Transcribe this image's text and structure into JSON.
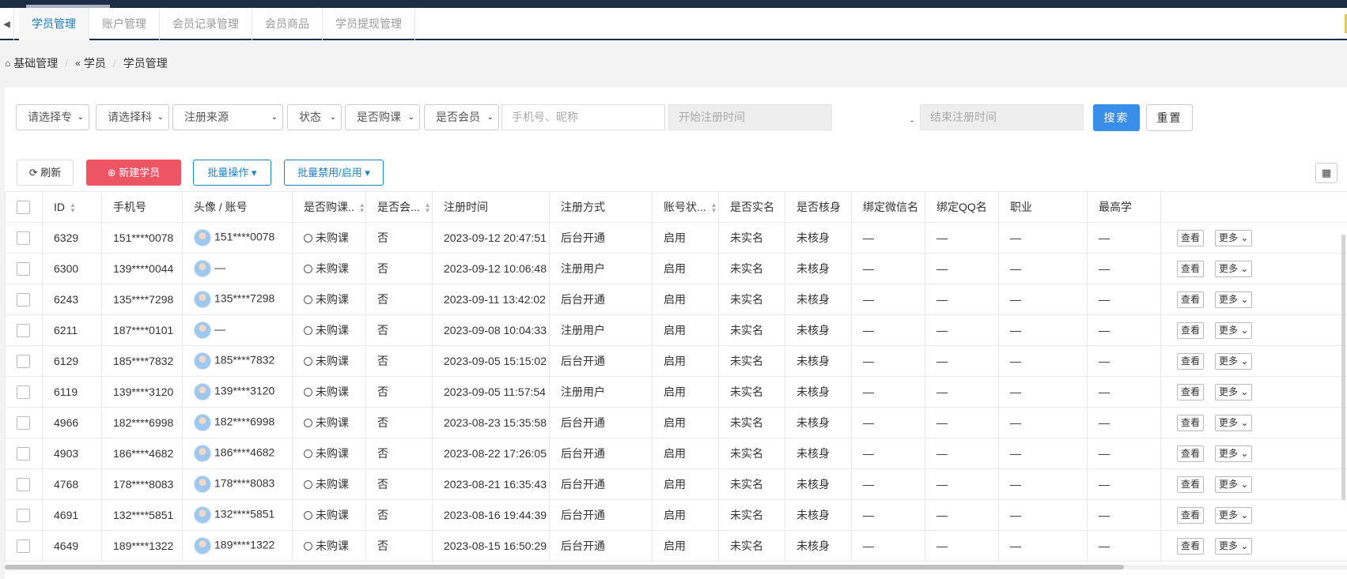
{
  "tabs": [
    {
      "label": "学员管理",
      "active": true
    },
    {
      "label": "账户管理"
    },
    {
      "label": "会员记录管理"
    },
    {
      "label": "会员商品"
    },
    {
      "label": "学员提现管理"
    }
  ],
  "breadcrumb": {
    "home_icon": "home-icon",
    "items": [
      "基础管理",
      "学员",
      "学员管理"
    ]
  },
  "filters": {
    "select1": "请选择专",
    "select2": "请选择科",
    "register_source": "注册来源",
    "status": "状态",
    "has_purchase": "是否购课",
    "is_member": "是否会员",
    "keyword_placeholder": "手机号、昵称",
    "start_date_placeholder": "开始注册时间",
    "date_dash": "-",
    "end_date_placeholder": "结束注册时间",
    "search_label": "搜索",
    "reset_label": "重置"
  },
  "toolbar": {
    "refresh_label": "刷新",
    "new_label": "新建学员",
    "batch_label": "批量操作",
    "ban_label": "批量禁用/启用"
  },
  "table": {
    "columns": [
      "ID",
      "手机号",
      "头像 / 账号",
      "是否购课..",
      "是否会...",
      "注册时间",
      "注册方式",
      "账号状...",
      "是否实名",
      "是否核身",
      "绑定微信名",
      "绑定QQ名",
      "职业",
      "最高学"
    ],
    "rows": [
      {
        "id": "6329",
        "phone": "151****0078",
        "account": "151****0078",
        "purchase": "未购课",
        "member": "否",
        "time": "2023-09-12 20:47:51",
        "method": "后台开通",
        "status": "启用",
        "realname": "未实名",
        "verify": "未核身",
        "wechat": "—",
        "qq": "—",
        "job": "—",
        "edu": "—"
      },
      {
        "id": "6300",
        "phone": "139****0044",
        "account": "—",
        "purchase": "未购课",
        "member": "否",
        "time": "2023-09-12 10:06:48",
        "method": "注册用户",
        "status": "启用",
        "realname": "未实名",
        "verify": "未核身",
        "wechat": "—",
        "qq": "—",
        "job": "—",
        "edu": "—"
      },
      {
        "id": "6243",
        "phone": "135****7298",
        "account": "135****7298",
        "purchase": "未购课",
        "member": "否",
        "time": "2023-09-11 13:42:02",
        "method": "后台开通",
        "status": "启用",
        "realname": "未实名",
        "verify": "未核身",
        "wechat": "—",
        "qq": "—",
        "job": "—",
        "edu": "—"
      },
      {
        "id": "6211",
        "phone": "187****0101",
        "account": "—",
        "purchase": "未购课",
        "member": "否",
        "time": "2023-09-08 10:04:33",
        "method": "注册用户",
        "status": "启用",
        "realname": "未实名",
        "verify": "未核身",
        "wechat": "—",
        "qq": "—",
        "job": "—",
        "edu": "—"
      },
      {
        "id": "6129",
        "phone": "185****7832",
        "account": "185****7832",
        "purchase": "未购课",
        "member": "否",
        "time": "2023-09-05 15:15:02",
        "method": "后台开通",
        "status": "启用",
        "realname": "未实名",
        "verify": "未核身",
        "wechat": "—",
        "qq": "—",
        "job": "—",
        "edu": "—"
      },
      {
        "id": "6119",
        "phone": "139****3120",
        "account": "139****3120",
        "purchase": "未购课",
        "member": "否",
        "time": "2023-09-05 11:57:54",
        "method": "注册用户",
        "status": "启用",
        "realname": "未实名",
        "verify": "未核身",
        "wechat": "—",
        "qq": "—",
        "job": "—",
        "edu": "—"
      },
      {
        "id": "4966",
        "phone": "182****6998",
        "account": "182****6998",
        "purchase": "未购课",
        "member": "否",
        "time": "2023-08-23 15:35:58",
        "method": "后台开通",
        "status": "启用",
        "realname": "未实名",
        "verify": "未核身",
        "wechat": "—",
        "qq": "—",
        "job": "—",
        "edu": "—"
      },
      {
        "id": "4903",
        "phone": "186****4682",
        "account": "186****4682",
        "purchase": "未购课",
        "member": "否",
        "time": "2023-08-22 17:26:05",
        "method": "后台开通",
        "status": "启用",
        "realname": "未实名",
        "verify": "未核身",
        "wechat": "—",
        "qq": "—",
        "job": "—",
        "edu": "—"
      },
      {
        "id": "4768",
        "phone": "178****8083",
        "account": "178****8083",
        "purchase": "未购课",
        "member": "否",
        "time": "2023-08-21 16:35:43",
        "method": "后台开通",
        "status": "启用",
        "realname": "未实名",
        "verify": "未核身",
        "wechat": "—",
        "qq": "—",
        "job": "—",
        "edu": "—"
      },
      {
        "id": "4691",
        "phone": "132****5851",
        "account": "132****5851",
        "purchase": "未购课",
        "member": "否",
        "time": "2023-08-16 19:44:39",
        "method": "后台开通",
        "status": "启用",
        "realname": "未实名",
        "verify": "未核身",
        "wechat": "—",
        "qq": "—",
        "job": "—",
        "edu": "—"
      },
      {
        "id": "4649",
        "phone": "189****1322",
        "account": "189****1322",
        "purchase": "未购课",
        "member": "否",
        "time": "2023-08-15 16:50:29",
        "method": "后台开通",
        "status": "启用",
        "realname": "未实名",
        "verify": "未核身",
        "wechat": "—",
        "qq": "—",
        "job": "—",
        "edu": "—"
      }
    ],
    "view_label": "查看",
    "more_label": "更多"
  },
  "colors": {
    "accent": "#1a7bb9",
    "primary_button": "#3b8ee8",
    "danger_button": "#ed5565",
    "enabled_status": "#1ab394",
    "header_bar": "#1f2d44"
  }
}
